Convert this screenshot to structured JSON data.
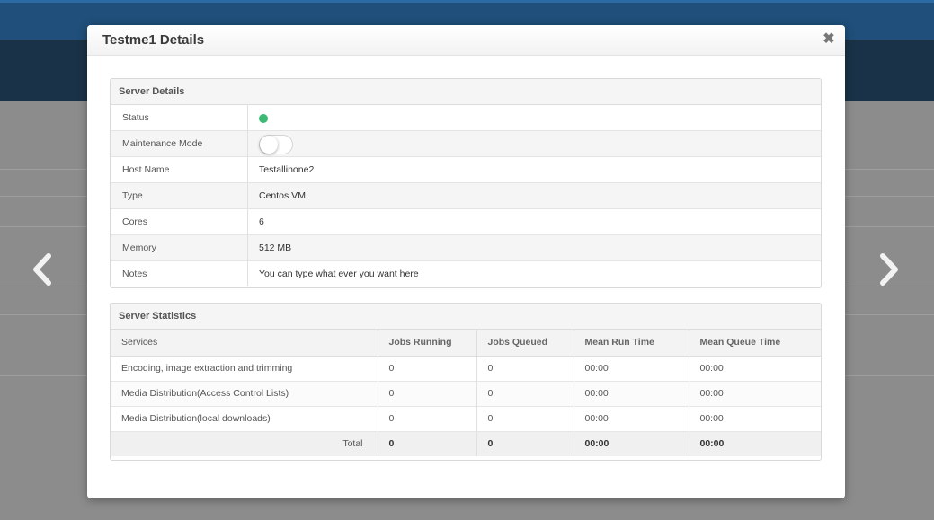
{
  "modal": {
    "title": "Testme1 Details",
    "close_glyph": "✖"
  },
  "server_details": {
    "heading": "Server Details",
    "rows": [
      {
        "label": "Status",
        "value": ""
      },
      {
        "label": "Maintenance Mode",
        "value": ""
      },
      {
        "label": "Host Name",
        "value": "Testallinone2"
      },
      {
        "label": "Type",
        "value": "Centos VM"
      },
      {
        "label": "Cores",
        "value": "6"
      },
      {
        "label": "Memory",
        "value": "512 MB"
      },
      {
        "label": "Notes",
        "value": "You can type what ever you want here"
      }
    ],
    "status_color": "#3cba74",
    "maintenance_mode_on": false
  },
  "server_statistics": {
    "heading": "Server Statistics",
    "columns": [
      "Services",
      "Jobs Running",
      "Jobs Queued",
      "Mean Run Time",
      "Mean Queue Time"
    ],
    "rows": [
      [
        "Encoding, image extraction and trimming",
        "0",
        "0",
        "00:00",
        "00:00"
      ],
      [
        "Media Distribution(Access Control Lists)",
        "0",
        "0",
        "00:00",
        "00:00"
      ],
      [
        "Media Distribution(local downloads)",
        "0",
        "0",
        "00:00",
        "00:00"
      ]
    ],
    "total": [
      "Total",
      "0",
      "0",
      "00:00",
      "00:00"
    ]
  },
  "icons": {
    "prev": "chevron-left-icon",
    "next": "chevron-right-icon",
    "close": "close-icon",
    "status": "status-dot-icon"
  }
}
